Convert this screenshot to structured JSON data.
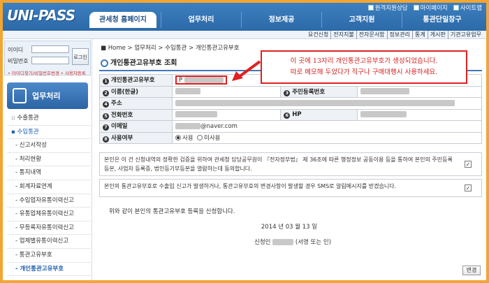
{
  "app": {
    "logo": "UNI-PASS",
    "logo_sub": ""
  },
  "util": [
    "원격지원상담",
    "마이페이지",
    "사이트맵"
  ],
  "home_tab": "관세청 홈페이지",
  "main_nav": [
    "업무처리",
    "정보제공",
    "고객지원",
    "통관단일창구"
  ],
  "sub_nav": [
    "요건신청",
    "전지지불",
    "전자문서함",
    "정보관리",
    "통계",
    "게시판",
    "기관고유업무"
  ],
  "login": {
    "id_label": "이이디",
    "pw_label": "비밀번호",
    "button": "로그인",
    "links": "• 아이디찾기/비밀번호변경 • 사용자등록"
  },
  "menu_title": "업무처리",
  "menu": [
    {
      "label": "수출통관",
      "type": "top"
    },
    {
      "label": "수입통관",
      "type": "sel"
    },
    {
      "label": "- 신고서작성",
      "type": "sub"
    },
    {
      "label": "- 처리현황",
      "type": "sub"
    },
    {
      "label": "- 통지내역",
      "type": "sub"
    },
    {
      "label": "- 회계자료연계",
      "type": "sub"
    },
    {
      "label": "- 수입업자유통이력신고",
      "type": "sub"
    },
    {
      "label": "- 유통업체유통이력신고",
      "type": "sub"
    },
    {
      "label": "- 무등록자유통이력신고",
      "type": "sub"
    },
    {
      "label": "- 업체별유통이력신고",
      "type": "sub"
    },
    {
      "label": "- 통관고유부호",
      "type": "sub"
    },
    {
      "label": "- 개인통관고유부호",
      "type": "cur"
    }
  ],
  "breadcrumb": "Home > 업무처리 > 수입통관 > 개인통관고유부호",
  "page_title": "개인통관고유부호 조회",
  "rows": {
    "code": {
      "num": "①",
      "label": "개인통관고유부호",
      "value_prefix": "P"
    },
    "name": {
      "num": "②",
      "label": "이름(한글)"
    },
    "rrn": {
      "num": "③",
      "label": "주민등록번호"
    },
    "address": {
      "num": "④",
      "label": "주소"
    },
    "phone": {
      "num": "⑤",
      "label": "전화번호"
    },
    "hp": {
      "num": "⑥",
      "label": "HP"
    },
    "email": {
      "num": "⑦",
      "label": "이메일",
      "value_suffix": "@naver.com"
    },
    "use": {
      "num": "⑧",
      "label": "사용여부",
      "opt_use": "사용",
      "opt_nouse": "미사용"
    }
  },
  "agree1": "본인은 이 건 신청내역의 정확한 검증을 위하여 관세청 담당공무원이 『전자정부법』 제 36조에 따른 행정정보 공동이용 등을 통하여 본인의 주민등록등본, 사업자 등록증, 법인등기부등본을 열람하는데 동의합니다.",
  "agree2": "본인의 통관고유부호로 수출입 신고가 발생하거나, 통관고유부호의 변경사항이 발생할 경우 SMS로 알림메시지를 받겠습니다.",
  "note": "위와 같이 본인의 통관고유부호 등록을 신청합니다.",
  "date": "2014 년 03 월 13 일",
  "sign_label": "신청인",
  "sign_suffix": "(서명 또는 인)",
  "edit_button": "변경",
  "callout_line1": "이 곳에 13자리 개인통관고유부호가 생성되었습니다.",
  "callout_line2": "따로 메모해 두었다가 직구나 구매대행시 사용하세요.",
  "colors": {
    "accent_blue": "#2c6aa8",
    "frame_orange": "#f3a531",
    "callout_red": "#e02020"
  }
}
